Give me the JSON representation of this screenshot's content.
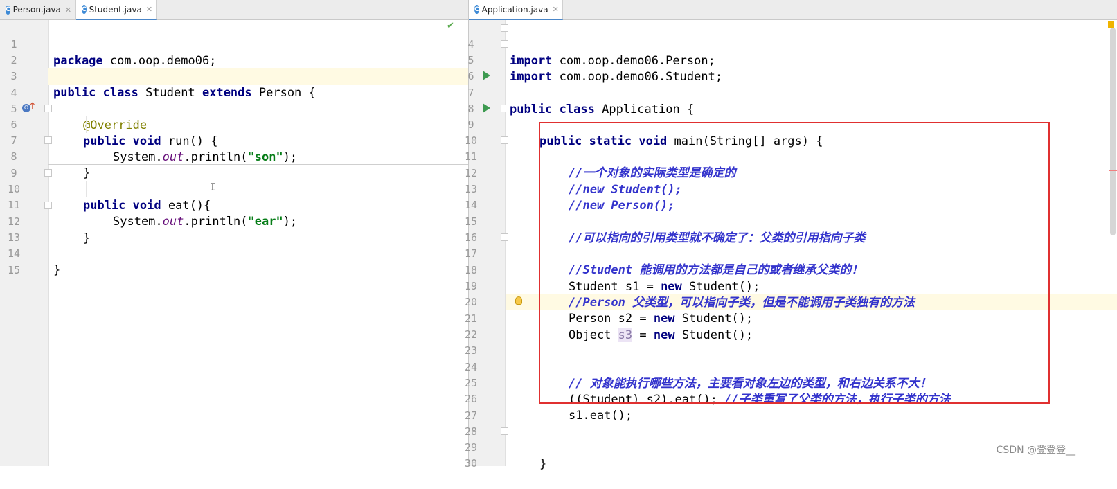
{
  "left_tabs": [
    {
      "label": "Person.java",
      "icon": "c-class-icon",
      "active": false
    },
    {
      "label": "Student.java",
      "icon": "c-class-icon",
      "active": true
    }
  ],
  "right_tabs": [
    {
      "label": "Application.java",
      "icon": "c-class-icon",
      "active": true
    }
  ],
  "left_editor": {
    "line_numbers": [
      "1",
      "2",
      "3",
      "4",
      "5",
      "6",
      "7",
      "8",
      "9",
      "10",
      "11",
      "12",
      "13",
      "14",
      "15"
    ],
    "lines": [
      {
        "k": "package",
        "rest": " com.oop.demo06;"
      },
      {},
      {
        "k1": "public",
        "k2": "class",
        "name": " Student ",
        "k3": "extends",
        "rest": " Person {"
      },
      {},
      {
        "ann": "@Override"
      },
      {
        "k1": "public",
        "k2": "void",
        "rest": " run() {"
      },
      {
        "a": "System.",
        "fld": "out",
        "b": ".println(",
        "str": "\"son\"",
        "c": ");"
      },
      {
        "rest": "}"
      },
      {},
      {
        "k1": "public",
        "k2": "void",
        "rest": " eat(){"
      },
      {
        "a": "System.",
        "fld": "out",
        "b": ".println(",
        "str": "\"ear\"",
        "c": ");"
      },
      {
        "rest": "}"
      },
      {},
      {
        "rest": "}"
      },
      {}
    ]
  },
  "right_editor": {
    "line_numbers": [
      "4",
      "5",
      "6",
      "7",
      "8",
      "9",
      "10",
      "11",
      "12",
      "13",
      "14",
      "15",
      "16",
      "17",
      "18",
      "19",
      "20",
      "21",
      "22",
      "23",
      "24",
      "25",
      "26",
      "27",
      "28",
      "29",
      "30"
    ],
    "import1": {
      "k": "import",
      "rest": " com.oop.demo06.Person;"
    },
    "import2": {
      "k": "import",
      "rest": " com.oop.demo06.Student;"
    },
    "class_decl": {
      "k1": "public",
      "k2": "class",
      "rest": " Application {"
    },
    "main_decl": {
      "k1": "public",
      "k2": "static",
      "k3": "void",
      "rest": " main(String[] args) {"
    },
    "c11": "//一个对象的实际类型是确定的",
    "c12": "//new Student();",
    "c13": "//new Person();",
    "c15": "//可以指向的引用类型就不确定了：父类的引用指向子类",
    "c17": "//Student 能调用的方法都是自己的或者继承父类的！",
    "l18": {
      "a": "Student s1 = ",
      "k": "new",
      "b": " Student();"
    },
    "c19": "//Person 父类型，可以指向子类，但是不能调用子类独有的方法",
    "l20": {
      "a": "Person s2 = ",
      "k": "new",
      "b": " Student();"
    },
    "l21": {
      "a": "Object ",
      "var": "s3",
      "b": " = ",
      "k": "new",
      "c": " Student();"
    },
    "c24": "// 对象能执行哪些方法，主要看对象左边的类型，和右边关系不大！",
    "l25": {
      "a": "((Student) s2).eat(); ",
      "cmt": "//子类重写了父类的方法，执行子类的方法"
    },
    "l26": "s1.eat();",
    "l29": "}"
  },
  "watermark": "CSDN @登登登__",
  "colors": {
    "keyword": "#000080",
    "string": "#067d17",
    "comment": "#3333cc",
    "annotation": "#808000",
    "highlight_line": "#fffae3",
    "red_box": "#e03030"
  }
}
